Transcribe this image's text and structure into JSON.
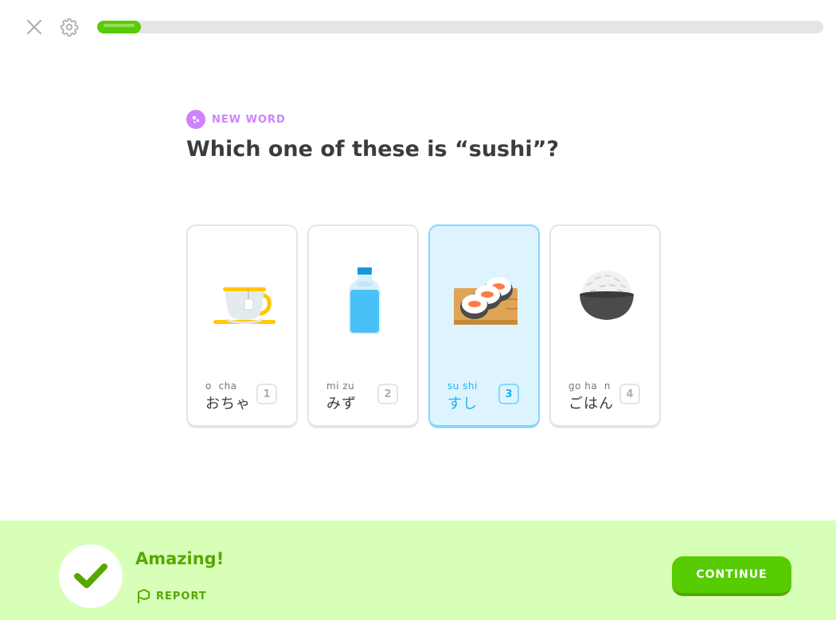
{
  "progress": {
    "fraction": 0.06
  },
  "challenge": {
    "badge_label": "NEW WORD",
    "question": "Which one of these is “sushi”?"
  },
  "choices": [
    {
      "ruby": "o  cha",
      "kana": "おちゃ",
      "key": "1",
      "icon": "teacup-icon",
      "selected": false
    },
    {
      "ruby": "mi zu",
      "kana": "みず",
      "key": "2",
      "icon": "water-bottle-icon",
      "selected": false
    },
    {
      "ruby": "su shi",
      "kana": "すし",
      "key": "3",
      "icon": "sushi-icon",
      "selected": true
    },
    {
      "ruby": "go ha  n",
      "kana": "ごはん",
      "key": "4",
      "icon": "rice-bowl-icon",
      "selected": false
    }
  ],
  "footer": {
    "title": "Amazing!",
    "report_label": "REPORT",
    "continue_label": "CONTINUE"
  },
  "colors": {
    "accent_green": "#58cc02",
    "dark_green": "#58a700",
    "footer_bg": "#d7ffb8",
    "selected_blue": "#1cb0f6",
    "selected_bg": "#ddf4ff",
    "badge_purple": "#ce82ff"
  }
}
